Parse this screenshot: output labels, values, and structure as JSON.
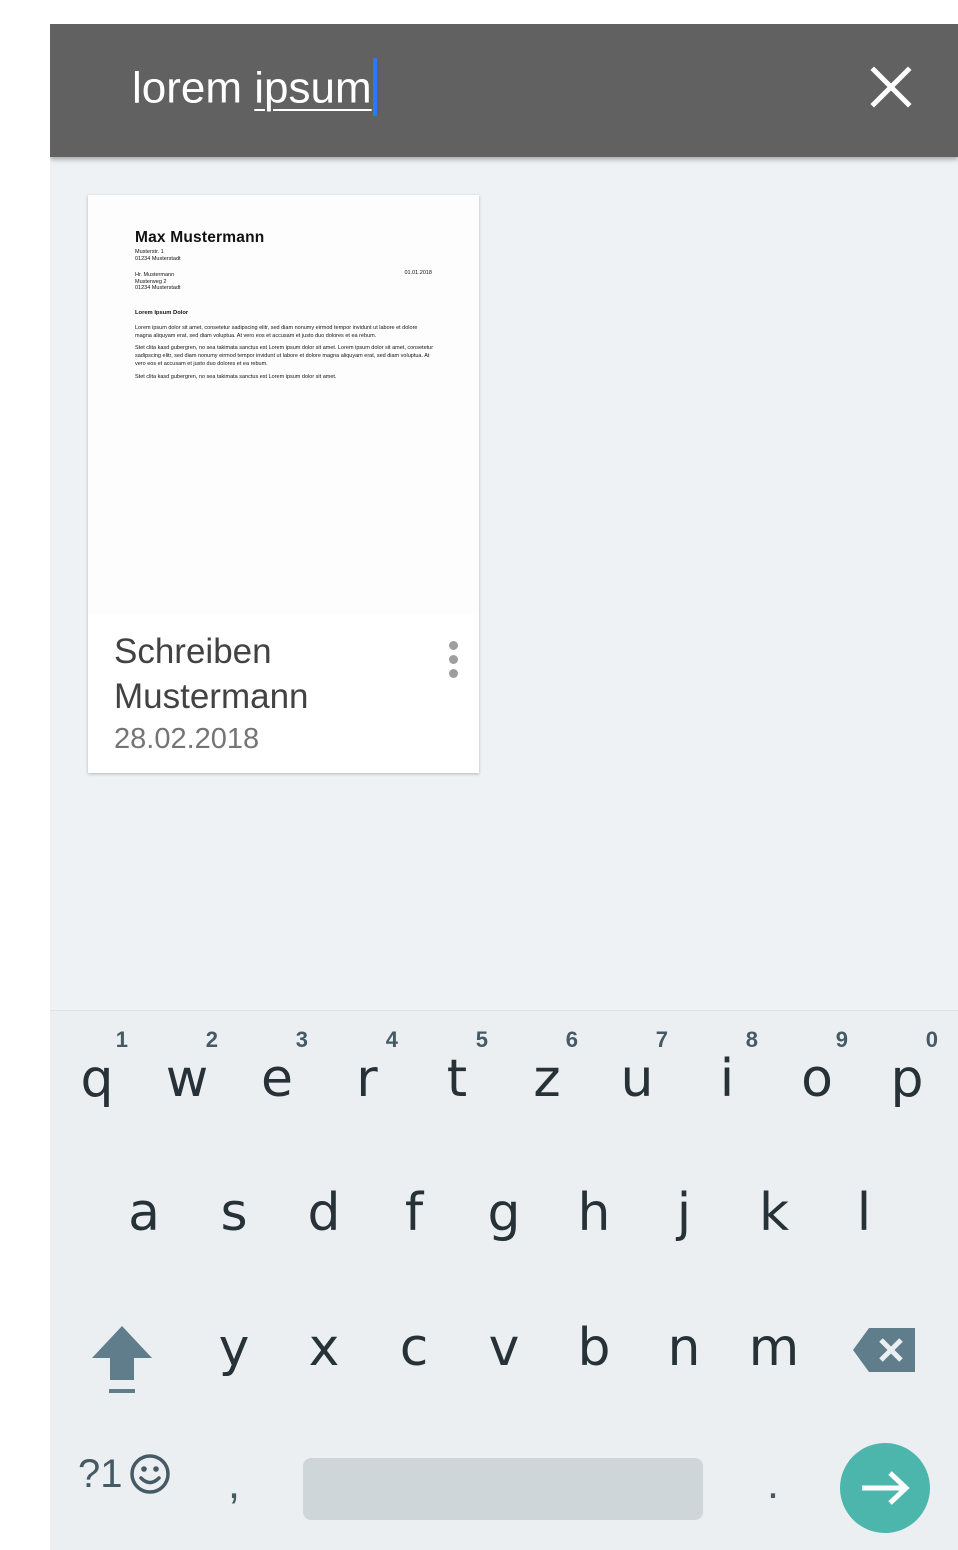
{
  "search": {
    "query_word1": "lorem",
    "query_word2": "ipsum"
  },
  "results": [
    {
      "preview": {
        "sender_name": "Max Mustermann",
        "sender_street": "Musterstr. 1",
        "sender_city": "01234 Musterstadt",
        "date": "01.01.2018",
        "recipient_name": "Hr. Mustermann",
        "recipient_street": "Musterweg 2",
        "recipient_city": "01234 Musterstadt",
        "subject": "Lorem Ipsum Dolor",
        "paragraph1": "Lorem ipsum dolor sit amet, consetetur sadipscing elitr, sed diam nonumy eirmod tempor invidunt ut labore et dolore magna aliquyam erat, sed diam voluptua. At vero eos et accusam et justo duo dolores et ea rebum.",
        "paragraph2": "Stet clita kasd gubergren, no sea takimata sanctus est Lorem ipsum dolor sit amet. Lorem ipsum dolor sit amet, consetetur sadipscing elitr, sed diam nonumy eirmod tempor invidunt ut labore et dolore magna aliquyam erat, sed diam voluptua. At vero eos et accusam et justo duo dolores et ea rebum.",
        "paragraph3": "Stet clita kasd gubergren, no sea takimata sanctus est Lorem ipsum dolor sit amet."
      },
      "title_line1": "Schreiben",
      "title_line2": "Mustermann",
      "date": "28.02.2018",
      "menu_icon": "more-vert-icon"
    }
  ],
  "keyboard": {
    "row1": [
      {
        "key": "q",
        "hint": "1"
      },
      {
        "key": "w",
        "hint": "2"
      },
      {
        "key": "e",
        "hint": "3"
      },
      {
        "key": "r",
        "hint": "4"
      },
      {
        "key": "t",
        "hint": "5"
      },
      {
        "key": "z",
        "hint": "6"
      },
      {
        "key": "u",
        "hint": "7"
      },
      {
        "key": "i",
        "hint": "8"
      },
      {
        "key": "o",
        "hint": "9"
      },
      {
        "key": "p",
        "hint": "0"
      }
    ],
    "row2": [
      "a",
      "s",
      "d",
      "f",
      "g",
      "h",
      "j",
      "k",
      "l"
    ],
    "row3": [
      "y",
      "x",
      "c",
      "v",
      "b",
      "n",
      "m"
    ],
    "symbols_label": "?1",
    "comma": ",",
    "period": ".",
    "icons": {
      "close": "close-icon",
      "shift": "shift-icon",
      "backspace": "backspace-icon",
      "emoji": "emoji-icon",
      "enter": "arrow-right-icon"
    }
  },
  "colors": {
    "toolbar": "#616161",
    "background": "#eef2f4",
    "caret": "#2979ff",
    "enter_key": "#4db6ac",
    "keyboard": "#eceff1"
  }
}
